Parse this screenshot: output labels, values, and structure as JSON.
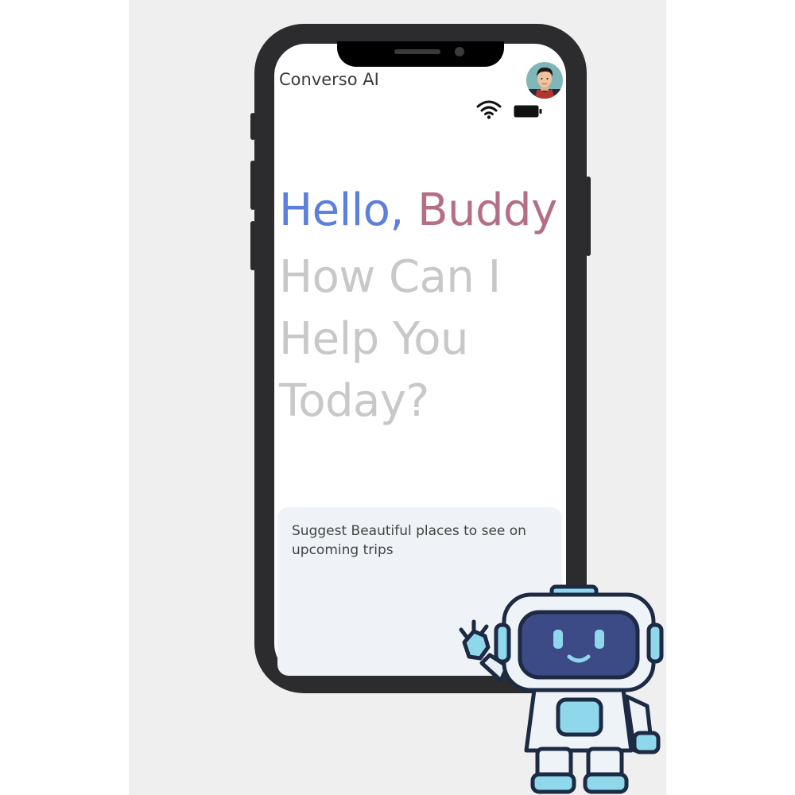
{
  "app": {
    "title": "Converso AI"
  },
  "status_bar": {
    "wifi_icon": "wifi-icon",
    "battery_icon": "battery-icon"
  },
  "profile": {
    "avatar_icon": "user-avatar"
  },
  "greeting": {
    "part1": "Hello,",
    "part2": "Buddy",
    "line2": "How Can I",
    "line3": "Help You",
    "line4": "Today?"
  },
  "suggestion": {
    "text": "Suggest Beautiful places to see on upcoming trips"
  },
  "colors": {
    "gradient_start": "#4f7ff0",
    "gradient_mid": "#b36a9a",
    "gradient_end": "#f06a44",
    "muted_text": "#c8c8c8",
    "card_bg": "#eff2f7"
  },
  "illustration": {
    "name": "robot-mascot"
  }
}
